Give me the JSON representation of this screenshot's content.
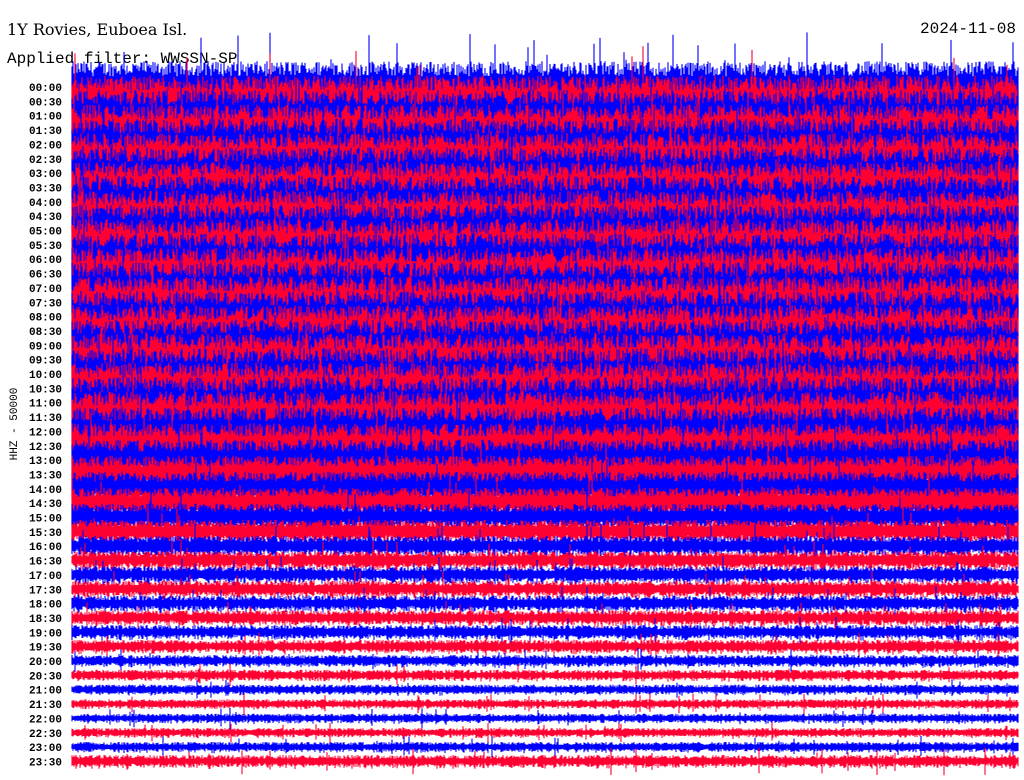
{
  "header": {
    "station": "1Y Rovies, Euboea Isl.",
    "filter": "Applied filter: WWSSN-SP",
    "date": "2024-11-08"
  },
  "chart_data": {
    "type": "line",
    "title": "1Y Rovies, Euboea Isl.",
    "subtitle": "Applied filter: WWSSN-SP",
    "ylabel": "HHZ - 50000",
    "colors": [
      "#0000ff",
      "#ff0033"
    ],
    "row_labels": [
      "00:00",
      "00:30",
      "01:00",
      "01:30",
      "02:00",
      "02:30",
      "03:00",
      "03:30",
      "04:00",
      "04:30",
      "05:00",
      "05:30",
      "06:00",
      "06:30",
      "07:00",
      "07:30",
      "08:00",
      "08:30",
      "09:00",
      "09:30",
      "10:00",
      "10:30",
      "11:00",
      "11:30",
      "12:00",
      "12:30",
      "13:00",
      "13:30",
      "14:00",
      "14:30",
      "15:00",
      "15:30",
      "16:00",
      "16:30",
      "17:00",
      "17:30",
      "18:00",
      "18:30",
      "19:00",
      "19:30",
      "20:00",
      "20:30",
      "21:00",
      "21:30",
      "22:00",
      "22:30",
      "23:00",
      "23:30"
    ],
    "relative_amplitude": [
      3,
      3,
      3,
      3,
      3,
      3,
      3,
      3,
      3,
      3,
      3,
      3,
      3,
      3,
      3,
      3,
      3,
      3,
      3,
      3,
      3,
      3,
      3,
      3,
      2.8,
      2.6,
      2.4,
      2.2,
      2,
      1.8,
      1.6,
      1.4,
      1.2,
      1.1,
      1.0,
      1.0,
      0.95,
      0.9,
      0.85,
      0.8,
      0.7,
      0.65,
      0.6,
      0.55,
      0.55,
      0.55,
      0.6,
      0.75
    ]
  }
}
